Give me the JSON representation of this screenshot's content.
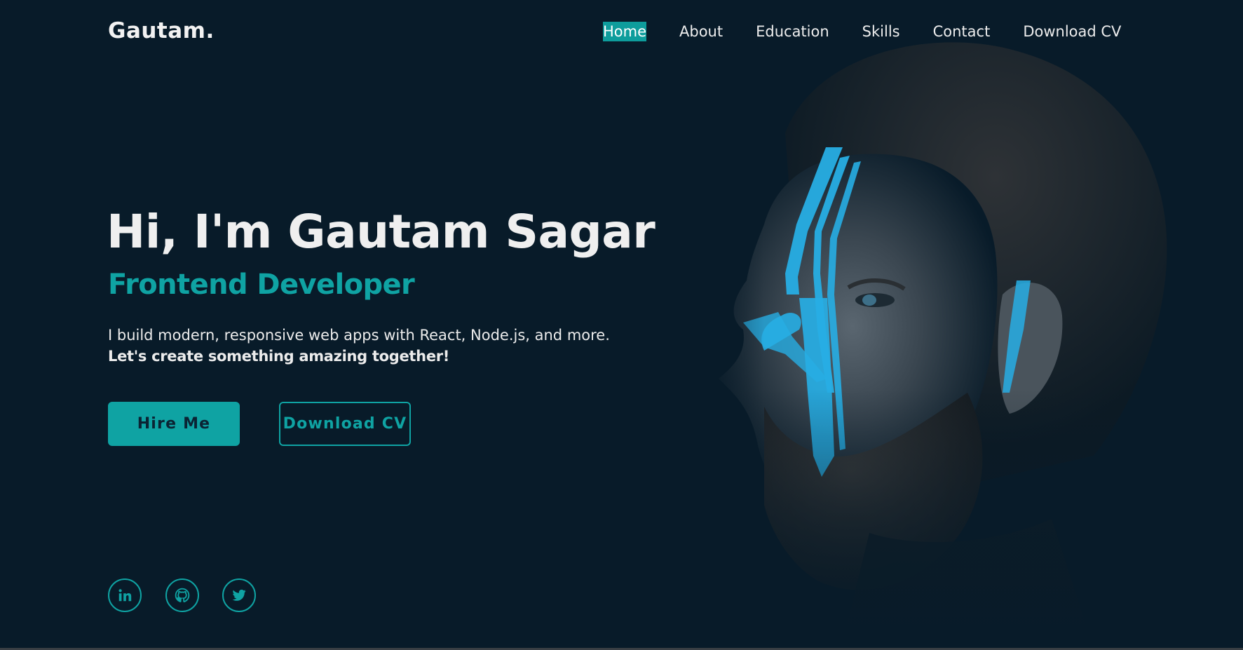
{
  "brand": {
    "logo": "Gautam."
  },
  "nav": {
    "items": [
      {
        "label": "Home",
        "active": true
      },
      {
        "label": "About"
      },
      {
        "label": "Education"
      },
      {
        "label": "Skills"
      },
      {
        "label": "Contact"
      },
      {
        "label": "Download CV"
      }
    ]
  },
  "hero": {
    "title": "Hi, I'm Gautam Sagar",
    "role": "Frontend Developer",
    "description": "I build modern, responsive web apps with React, Node.js, and more.",
    "tagline": "Let's create something amazing together!",
    "buttons": {
      "primary": "Hire Me",
      "secondary": "Download CV"
    }
  },
  "social": [
    {
      "icon": "linkedin-icon"
    },
    {
      "icon": "github-icon"
    },
    {
      "icon": "twitter-icon"
    }
  ],
  "colors": {
    "background": "#081b29",
    "accent": "#0fa3a3",
    "text": "#efefef",
    "face_paint": "#27aee4"
  }
}
